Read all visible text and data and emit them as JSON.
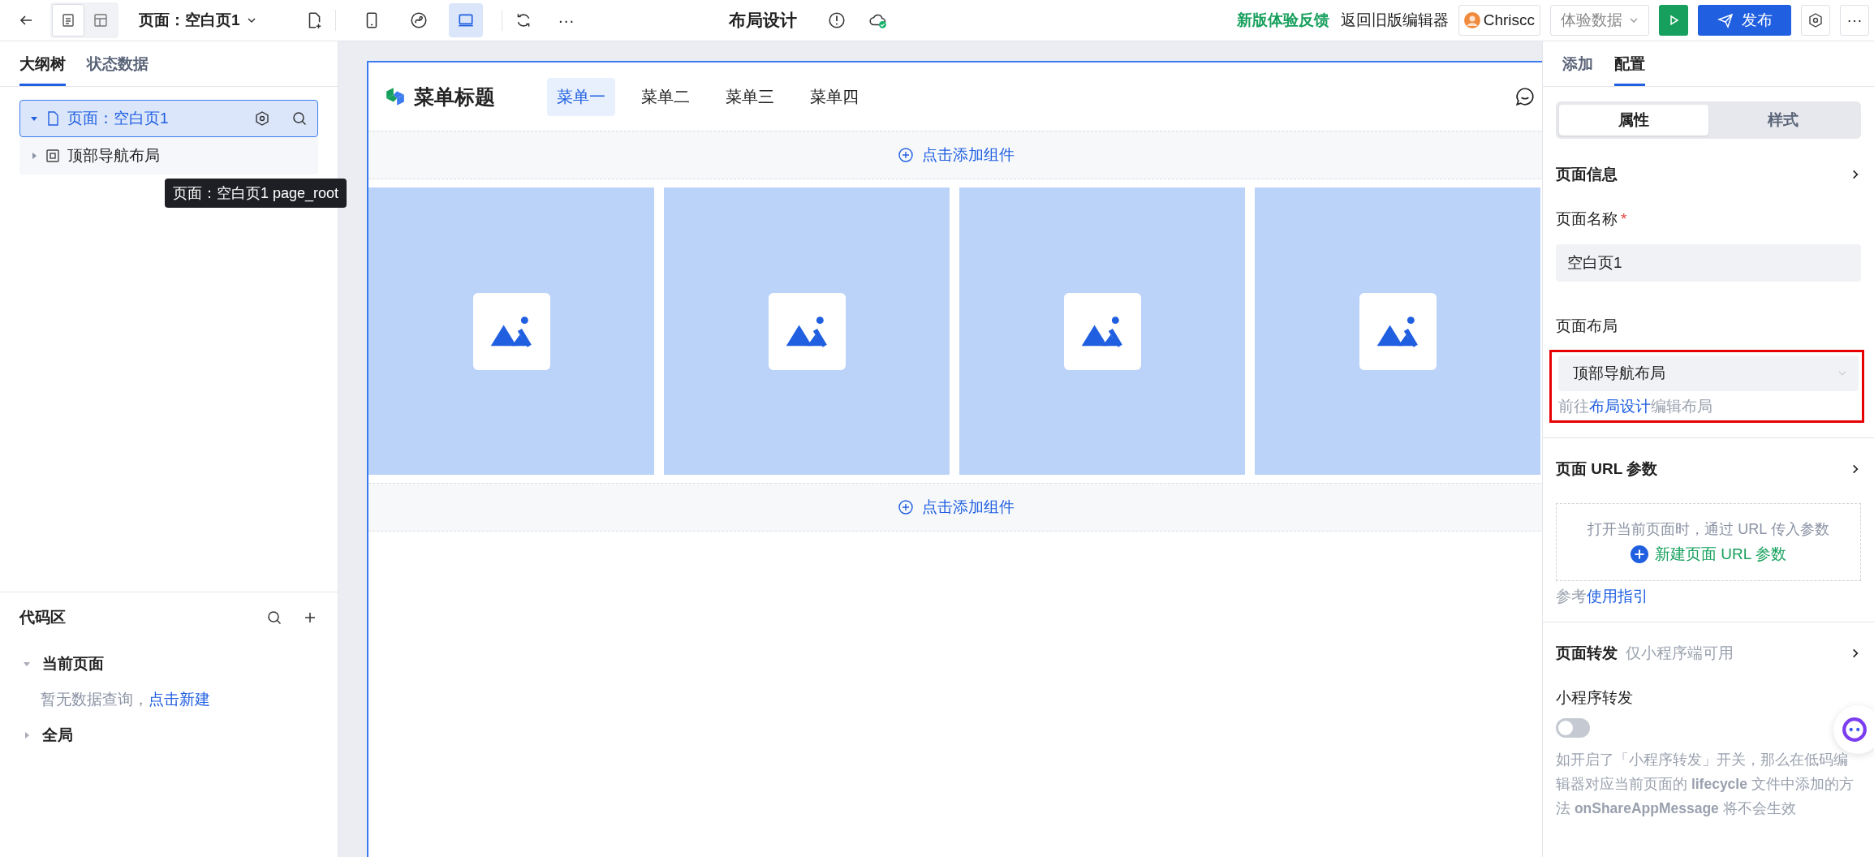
{
  "topbar": {
    "view_modes": [
      {
        "kind": "page",
        "selected": true
      },
      {
        "kind": "layout",
        "selected": false
      }
    ],
    "page_selector": "页面：空白页1",
    "devices": [
      {
        "kind": "mobile",
        "selected": false
      },
      {
        "kind": "miniprogram",
        "selected": false
      },
      {
        "kind": "desktop",
        "selected": true
      }
    ],
    "more": "···",
    "title": "布局设计",
    "feedback_link": "新版体验反馈",
    "old_editor": "返回旧版编辑器",
    "user": "Chriscc",
    "data_select": "体验数据",
    "publish": "发布",
    "more_right": "···"
  },
  "left_panel": {
    "tabs": [
      {
        "label": "大纲树",
        "selected": true
      },
      {
        "label": "状态数据",
        "selected": false
      }
    ],
    "tree": [
      {
        "label": "页面：空白页1",
        "kind": "page",
        "selected": true,
        "expanded": true,
        "children": [
          {
            "label": "顶部导航布局",
            "kind": "layout",
            "selected": false,
            "expanded": false
          }
        ]
      }
    ],
    "tooltip": "页面：空白页1 page_root",
    "code_area": {
      "title": "代码区",
      "groups": [
        {
          "label": "当前页面",
          "expanded": true,
          "empty_text": "暂无数据查询，",
          "action": "点击新建"
        },
        {
          "label": "全局",
          "expanded": false
        }
      ]
    }
  },
  "canvas": {
    "title": "菜单标题",
    "menu": [
      {
        "label": "菜单一",
        "selected": true
      },
      {
        "label": "菜单二",
        "selected": false
      },
      {
        "label": "菜单三",
        "selected": false
      },
      {
        "label": "菜单四",
        "selected": false
      }
    ],
    "add_top": "点击添加组件",
    "tiles": [
      {
        "kind": "image"
      },
      {
        "kind": "image"
      },
      {
        "kind": "image"
      },
      {
        "kind": "image"
      }
    ],
    "add_bottom": "点击添加组件"
  },
  "right_panel": {
    "tabs": [
      {
        "label": "添加",
        "selected": false
      },
      {
        "label": "配置",
        "selected": true
      }
    ],
    "segments": [
      {
        "label": "属性",
        "selected": true
      },
      {
        "label": "样式",
        "selected": false
      }
    ],
    "page_info": {
      "title": "页面信息",
      "name_label": "页面名称",
      "required_mark": "*",
      "name_value": "空白页1",
      "layout_label": "页面布局",
      "layout_value": "顶部导航布局",
      "highlighted": true,
      "hint_prefix": "前往",
      "hint_link": "布局设计",
      "hint_suffix": "编辑布局"
    },
    "url_params": {
      "title": "页面 URL 参数",
      "empty_text": "打开当前页面时，通过 URL 传入参数",
      "add": "新建页面 URL 参数",
      "ref_prefix": "参考",
      "ref_link": "使用指引"
    },
    "forward": {
      "title": "页面转发",
      "note": "仅小程序端可用",
      "label": "小程序转发",
      "on": false,
      "description": "如开启了「小程序转发」开关，那么在低码编辑器对应当前页面的 **lifecycle** 文件中添加的方法 **onShareAppMessage** 将不会生效"
    }
  }
}
